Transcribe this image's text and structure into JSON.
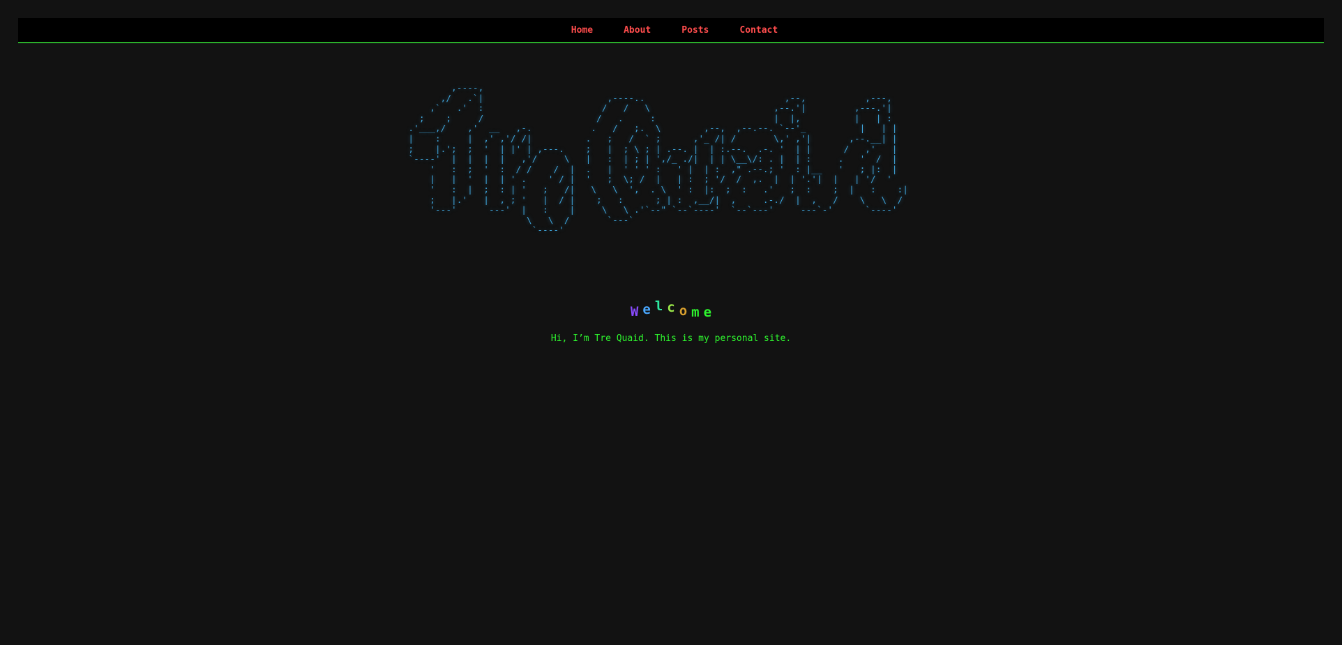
{
  "nav": {
    "items": [
      {
        "label": "Home"
      },
      {
        "label": "About"
      },
      {
        "label": "Posts"
      },
      {
        "label": "Contact"
      }
    ]
  },
  "banner": {
    "ascii_alt": "Tre Quaid",
    "ascii": "          ,----,\n        ,/   .`|\n      ,`   .'  :\n    ;    ;     /\n  .'___,/    ,'  __   ,-.\n  |    :     |  ,' ,'/ /|\n  ;    |.';  ;  '  | |' | ,---.\n  `----'  |  |  |  |   ,'/     \\\n      '   :  ;  '  :  / /    /  |\n      |   |  '  |  | ' .    ' / |\n      '   :  |  ;  : | '   ;   /|\n      ;   |.'   |  , ; '   |  / |\n      '---'      ---'  |   :    |\n                        \\   \\  /\n                         `----'",
    "ascii2": "     ,----..                          ,--,           ,---,\n    /   /   \\                       ,--.'|         ,---.'|\n   /   .     :                      |  |,          |   | :\n  .   /   ;.  \\        ,--,  ,--.--. `--'_          |   | |\n .   ;   /  ` ;      ,'_ /| /       \\,' ,'|       ,--.__| |\n ;   |  ; \\ ; | .--. |  | :.--.  .-. '  | |      /   ,'   |\n |   :  | ; | ',/_ ./|  | | \\__\\/: . |  | :     .   '  /  |\n .   |  ' ' ' :   ' |  | :  ,\" .--.; '  : |__   '   ; |:  |\n '   ;  \\; /  |   | :  ; '/  /  ,.  |  | '.'|  |   | '/  '\n  \\   \\  ',  . \\  ' :  |:  ;  :   .'   ;  :    ;  |   :    :|\n   ;   :      ; | :  ,__/|  ,     .-./  |  ,   /    \\   \\  /\n    \\   \\ .'`--\" `--`----'  `--`---'     ---`-'      `----'\n     `---`",
    "welcome_letters": [
      {
        "char": "W",
        "color": "#8a4bff"
      },
      {
        "char": "e",
        "color": "#4aa8ff"
      },
      {
        "char": "l",
        "color": "#2ee8a0"
      },
      {
        "char": "c",
        "color": "#9be84a"
      },
      {
        "char": "o",
        "color": "#d9a02e"
      },
      {
        "char": "m",
        "color": "#2ef52e"
      },
      {
        "char": "e",
        "color": "#2ef52e"
      }
    ],
    "intro": "Hi, I’m Tre Quaid. This is my personal site."
  },
  "colors": {
    "background": "#121212",
    "nav_background": "#000000",
    "nav_border": "#2bb02b",
    "nav_link": "#ff4d4d",
    "ascii": "#3fa3d8",
    "intro": "#2ef52e"
  }
}
